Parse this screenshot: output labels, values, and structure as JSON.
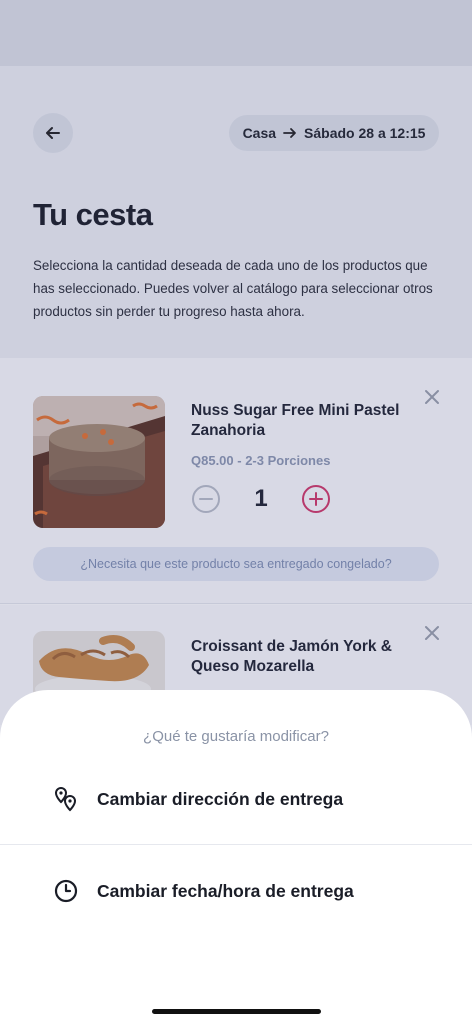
{
  "header": {
    "back_icon": "arrow-left-icon",
    "delivery_from": "Casa",
    "delivery_arrow_icon": "arrow-right-icon",
    "delivery_time": "Sábado 28 a 12:15",
    "title": "Tu cesta",
    "description": "Selecciona la cantidad deseada de cada uno de los productos que has seleccionado. Puedes volver al catálogo para seleccionar otros productos sin perder tu progreso hasta ahora."
  },
  "cart": {
    "items": [
      {
        "name": "Nuss Sugar Free Mini Pastel Zanahoria",
        "price_line": "Q85.00 - 2-3 Porciones",
        "quantity": "1",
        "frozen_prompt": "¿Necesita que este producto sea entregado congelado?"
      },
      {
        "name": "Croissant de Jamón York & Queso Mozarella"
      }
    ]
  },
  "sheet": {
    "title": "¿Qué te gustaría modificar?",
    "options": [
      {
        "label": "Cambiar dirección de entrega",
        "icon": "location-pins-icon"
      },
      {
        "label": "Cambiar fecha/hora de entrega",
        "icon": "clock-icon"
      }
    ]
  },
  "colors": {
    "accent": "#d2386a",
    "muted_blue": "#8d98b2",
    "overlay": "#3e4378"
  }
}
